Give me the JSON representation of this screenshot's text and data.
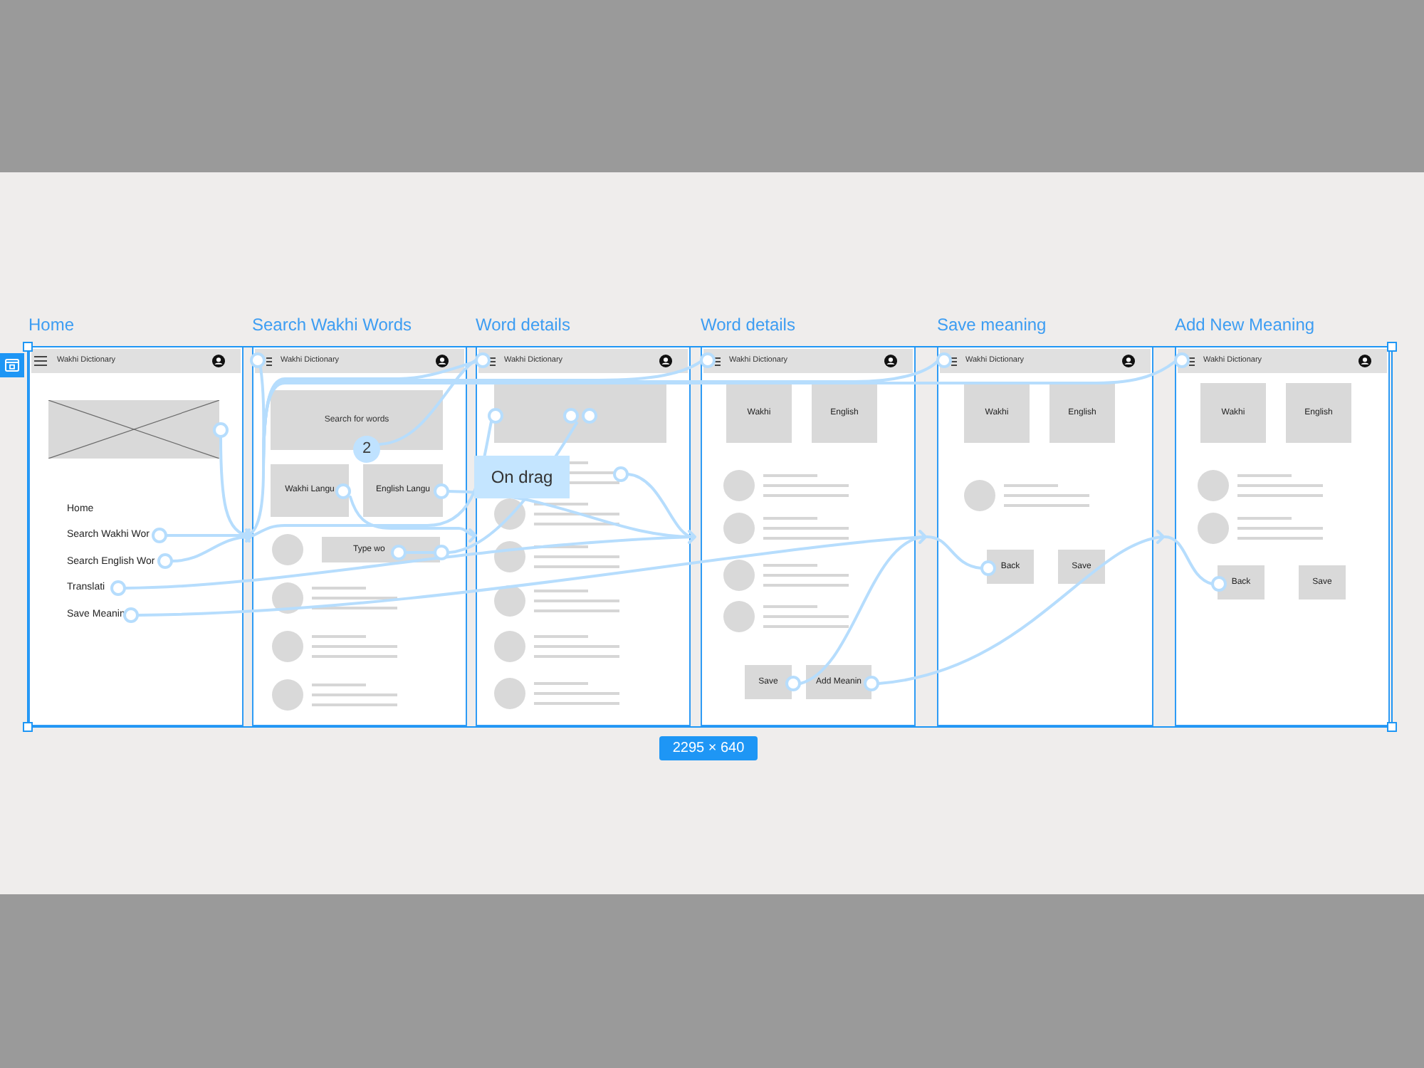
{
  "canvas": {
    "selection_size": "2295 × 640",
    "interaction_label": "On drag",
    "connection_badge": "2"
  },
  "frames": [
    {
      "title": "Home",
      "header": {
        "title": "Wakhi Dictionary"
      },
      "blocks": [
        {
          "kind": "image"
        },
        {
          "kind": "menu",
          "items": [
            "Home",
            "Search Wakhi Wor",
            "Search English Wor",
            "Translati",
            "Save Meanin"
          ]
        }
      ]
    },
    {
      "title": "Search Wakhi Words",
      "header": {
        "title": "Wakhi Dictionary"
      },
      "blocks": [
        {
          "kind": "search",
          "placeholder": "Search for words"
        },
        {
          "kind": "buttons",
          "items": [
            "Wakhi Langu",
            "English Langu"
          ]
        },
        {
          "kind": "input_row",
          "placeholder": "Type wo"
        },
        {
          "kind": "list_row"
        },
        {
          "kind": "list_row"
        },
        {
          "kind": "list_row"
        }
      ]
    },
    {
      "title": "Word details",
      "header": {
        "title": "Wakhi Dictionary"
      },
      "blocks": [
        {
          "kind": "banner"
        },
        {
          "kind": "list_row"
        },
        {
          "kind": "list_row"
        },
        {
          "kind": "list_row"
        },
        {
          "kind": "list_row"
        },
        {
          "kind": "list_row"
        },
        {
          "kind": "list_row"
        }
      ]
    },
    {
      "title": "Word details",
      "header": {
        "title": "Wakhi Dictionary"
      },
      "blocks": [
        {
          "kind": "tiles",
          "items": [
            "Wakhi",
            "English"
          ]
        },
        {
          "kind": "list_row"
        },
        {
          "kind": "list_row"
        },
        {
          "kind": "list_row"
        },
        {
          "kind": "list_row"
        },
        {
          "kind": "buttons",
          "items": [
            "Save",
            "Add Meanin"
          ]
        }
      ]
    },
    {
      "title": "Save meaning",
      "header": {
        "title": "Wakhi Dictionary"
      },
      "blocks": [
        {
          "kind": "tiles",
          "items": [
            "Wakhi",
            "English"
          ]
        },
        {
          "kind": "list_row"
        },
        {
          "kind": "buttons",
          "items": [
            "Back",
            "Save"
          ]
        }
      ]
    },
    {
      "title": "Add New Meaning",
      "header": {
        "title": "Wakhi Dictionary"
      },
      "blocks": [
        {
          "kind": "tiles",
          "items": [
            "Wakhi",
            "English"
          ]
        },
        {
          "kind": "list_row"
        },
        {
          "kind": "list_row"
        },
        {
          "kind": "buttons",
          "items": [
            "Back",
            "Save"
          ]
        }
      ]
    }
  ]
}
